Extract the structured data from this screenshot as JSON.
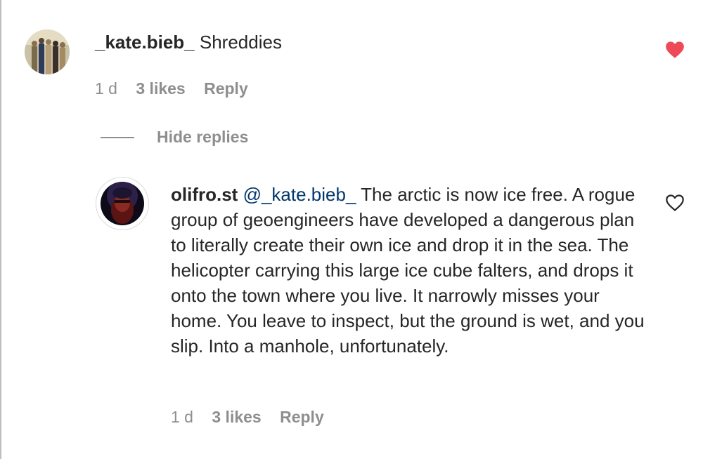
{
  "comment": {
    "username": "_kate.bieb_",
    "text": "Shreddies",
    "time": "1 d",
    "likes": "3 likes",
    "reply_label": "Reply",
    "liked": true,
    "like_color": "#ed4956"
  },
  "replies_toggle": {
    "label": "Hide replies"
  },
  "reply": {
    "username": "olifro.st",
    "mention": "@_kate.bieb_",
    "text": " The arctic is now ice free. A rogue group of geoengineers have developed a dangerous plan to literally create their own ice and drop it in the sea. The helicopter carrying this large ice cube falters, and drops it onto the town where you live. It narrowly misses your home. You leave to inspect, but the ground is wet, and you slip. Into a manhole, unfortunately.",
    "time": "1 d",
    "likes": "3 likes",
    "reply_label": "Reply",
    "liked": false
  }
}
